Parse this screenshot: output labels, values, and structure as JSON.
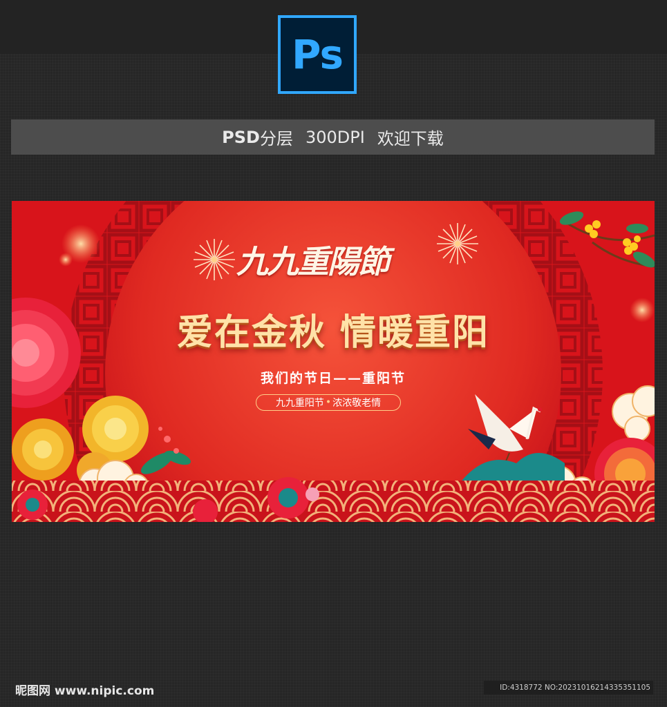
{
  "header": {
    "logo_text": "Ps",
    "info_bold": "PSD",
    "info_layer": "分层",
    "info_dpi": "300DPI",
    "info_download": "欢迎下载"
  },
  "banner": {
    "calligraphy_title": "九九重陽節",
    "headline": "爱在金秋 情暖重阳",
    "subtitle": "我们的节日——重阳节",
    "pill_left": "九九重阳节",
    "pill_dot": "•",
    "pill_right": "浓浓敬老情",
    "colors": {
      "background": "#d8141b",
      "headline": "#ffe2a8",
      "gold": "#ffd08a",
      "teal": "#1b8a8a"
    }
  },
  "footer": {
    "watermark": "昵图网 www.nipic.com",
    "id_text": "ID:4318772 NO:20231016214335351105"
  }
}
